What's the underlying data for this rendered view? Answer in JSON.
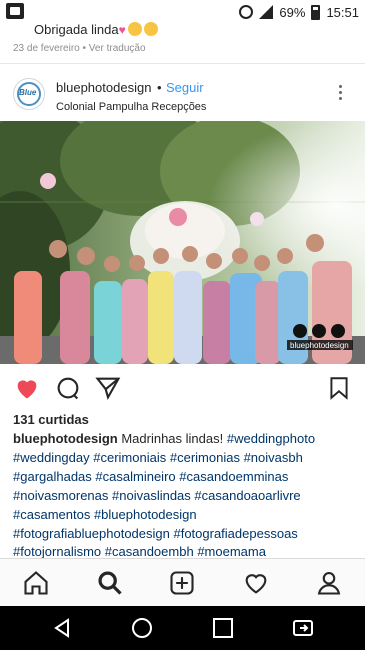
{
  "status_bar": {
    "battery": "69%",
    "time": "15:51"
  },
  "previous_post": {
    "comment_text": "Obrigada linda",
    "meta_date": "23 de fevereiro",
    "meta_sep": "•",
    "meta_action": "Ver tradução"
  },
  "post": {
    "username": "bluephotodesign",
    "follow_sep": "•",
    "follow_label": "Seguir",
    "location": "Colonial Pampulha Recepções",
    "avatar_text": "Blue",
    "watermark": "bluephotodesign",
    "likes": "131 curtidas",
    "caption_user": "bluephotodesign",
    "caption_text": "Madrinhas lindas!",
    "hashtags": [
      "#weddingphoto",
      "#weddingday",
      "#cerimoniais",
      "#cerimonias",
      "#noivasbh",
      "#gargalhadas",
      "#casalmineiro",
      "#casandoemminas",
      "#noivasmorenas",
      "#noivaslindas",
      "#casandoaoarlivre",
      "#casamentos",
      "#bluephotodesign",
      "#fotografiabluephotodesign",
      "#fotografiadepessoas",
      "#fotojornalismo",
      "#casandoembh",
      "#moemama"
    ]
  },
  "colors": {
    "like_red": "#ed4956",
    "link_blue": "#3897f0",
    "hashtag_blue": "#003569"
  },
  "bottom_nav": [
    "home-icon",
    "search-icon",
    "add-post-icon",
    "activity-heart-icon",
    "profile-icon"
  ],
  "android_nav": [
    "back-icon",
    "home-circle-icon",
    "recents-icon",
    "screen-mirror-icon"
  ]
}
